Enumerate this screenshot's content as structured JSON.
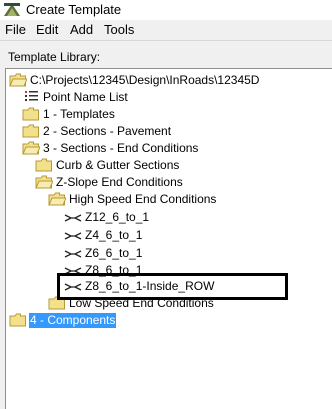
{
  "window": {
    "title": "Create Template",
    "icon": "template-app-icon"
  },
  "menu": [
    {
      "label": "File"
    },
    {
      "label": "Edit"
    },
    {
      "label": "Add"
    },
    {
      "label": "Tools"
    }
  ],
  "library_label": "Template Library:",
  "tree": [
    {
      "label": "C:\\Projects\\12345\\Design\\InRoads\\12345D",
      "icon": "folder-open-icon"
    },
    {
      "label": "Point Name List",
      "icon": "point-list-icon"
    },
    {
      "label": "1 - Templates",
      "icon": "folder-icon"
    },
    {
      "label": "2 - Sections - Pavement",
      "icon": "folder-icon"
    },
    {
      "label": "3 - Sections - End Conditions",
      "icon": "folder-open-icon"
    },
    {
      "label": "Curb & Gutter Sections",
      "icon": "folder-icon"
    },
    {
      "label": "Z-Slope End Conditions",
      "icon": "folder-open-icon"
    },
    {
      "label": "High Speed End Conditions",
      "icon": "folder-open-icon"
    },
    {
      "label": "Z12_6_to_1",
      "icon": "template-icon"
    },
    {
      "label": "Z4_6_to_1",
      "icon": "template-icon"
    },
    {
      "label": "Z6_6_to_1",
      "icon": "template-icon"
    },
    {
      "label": "Z8_6_to_1",
      "icon": "template-icon"
    },
    {
      "label": "Z8_6_to_1-Inside_ROW",
      "icon": "template-icon"
    },
    {
      "label": "Low Speed End Conditions",
      "icon": "folder-icon"
    },
    {
      "label": "4 - Components",
      "icon": "folder-icon",
      "selected": true
    }
  ],
  "colors": {
    "folder": "#f3e08a",
    "folder_edge": "#b59a3a",
    "selection": "#3399ff"
  }
}
